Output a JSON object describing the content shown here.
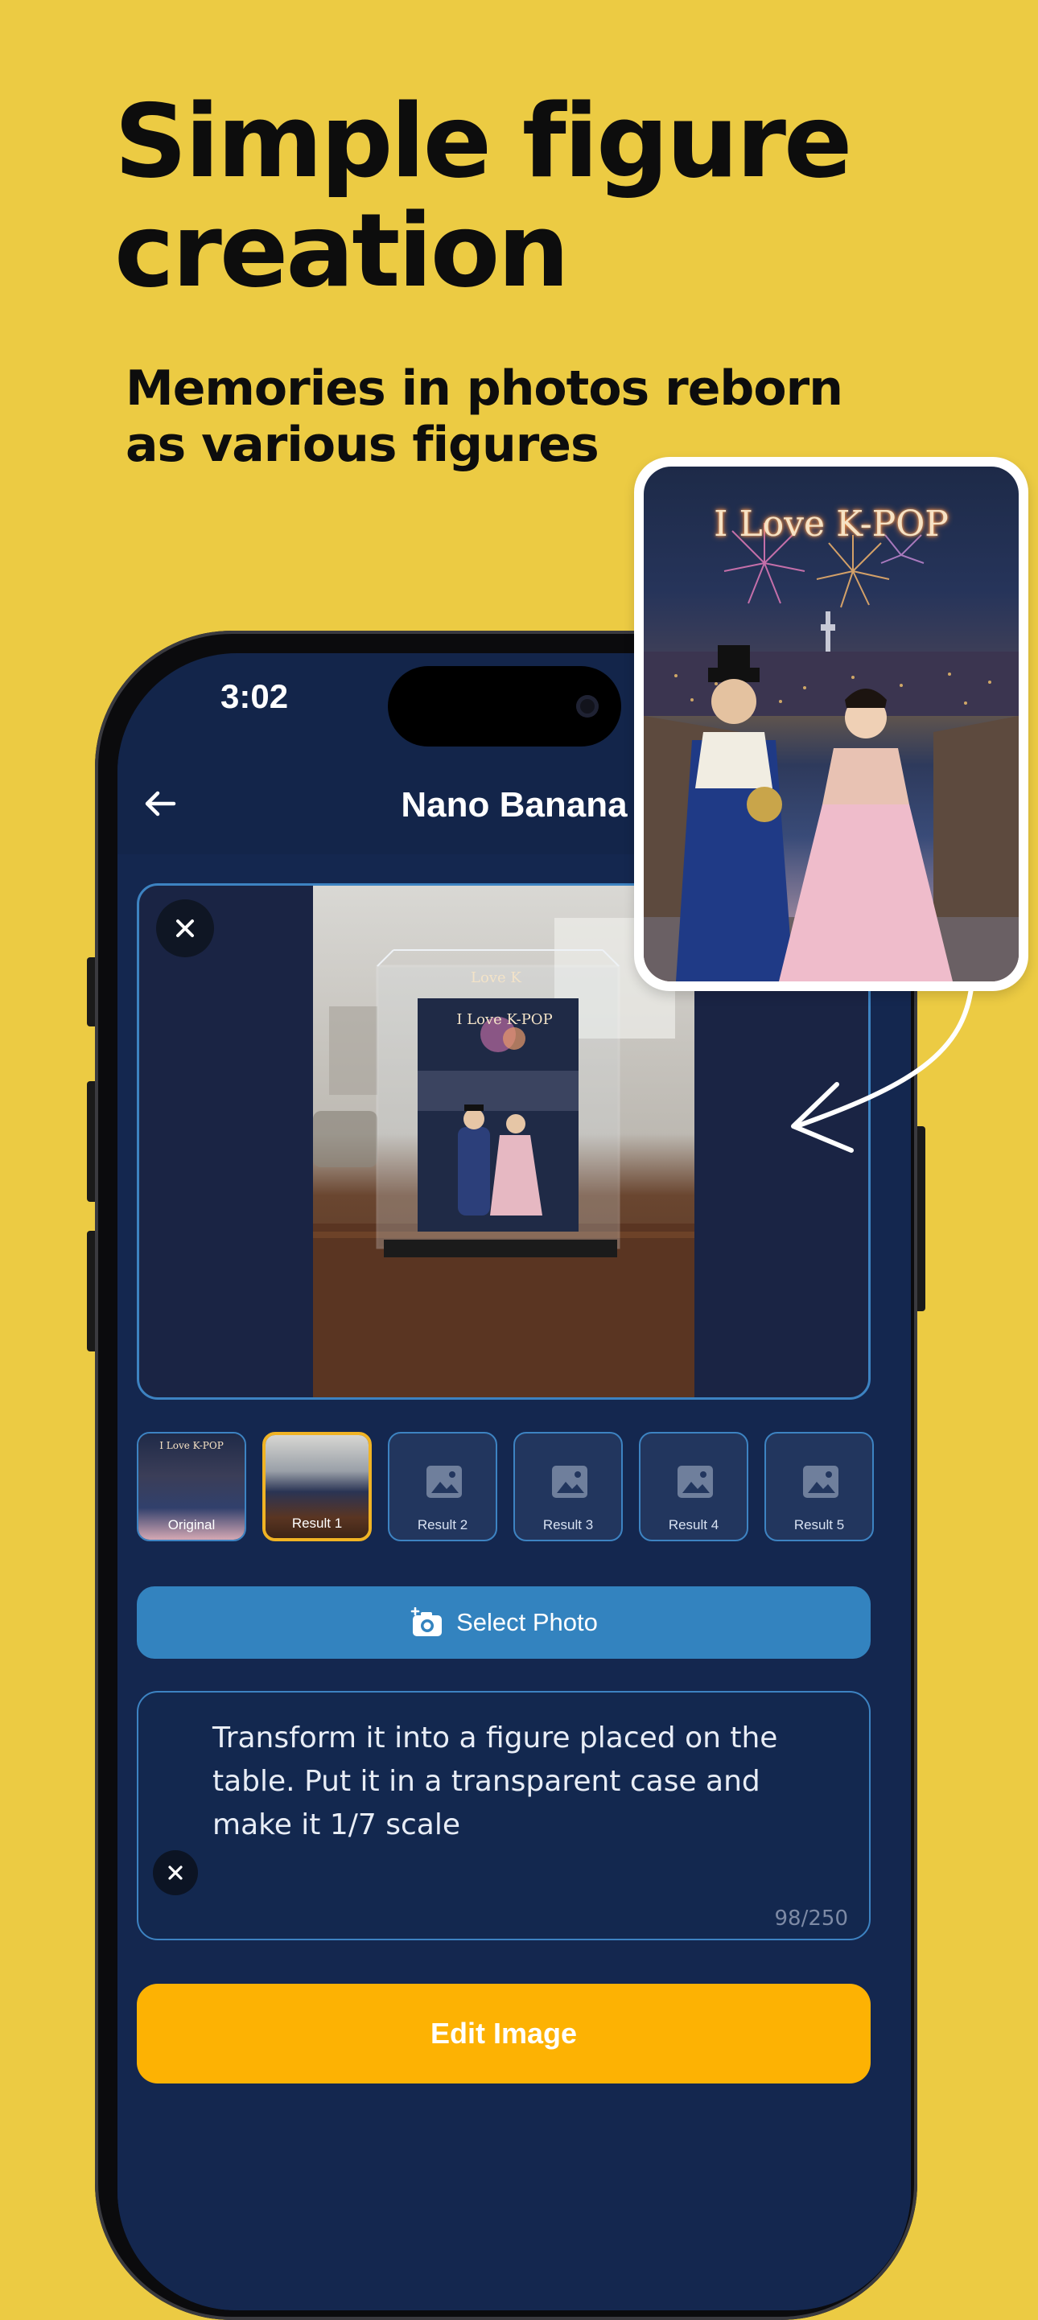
{
  "headline": "Simple figure creation",
  "subheadline": "Memories in photos reborn as various figures",
  "status_bar": {
    "time": "3:02"
  },
  "app_bar": {
    "title": "Nano Banana"
  },
  "preview": {
    "inner_caption_top": "Love K",
    "inner_caption": "I Love K-POP"
  },
  "popout": {
    "caption": "I Love K-POP"
  },
  "thumbnails": [
    {
      "label": "Original",
      "caption": "I Love K-POP",
      "state": "filled"
    },
    {
      "label": "Result 1",
      "state": "selected"
    },
    {
      "label": "Result 2",
      "state": "empty"
    },
    {
      "label": "Result 3",
      "state": "empty"
    },
    {
      "label": "Result 4",
      "state": "empty"
    },
    {
      "label": "Result 5",
      "state": "empty"
    }
  ],
  "select_photo": {
    "label": "Select Photo",
    "icon": "camera-plus-icon"
  },
  "prompt": {
    "text": "Transform it into a figure placed on the table. Put it in a transparent case and make it 1/7 scale",
    "counter": "98/250"
  },
  "edit_button": {
    "label": "Edit Image"
  },
  "colors": {
    "page_bg": "#ECCB43",
    "screen_bg": "#13254a",
    "accent_blue": "#3383bf",
    "accent_yellow": "#FDB203",
    "selected_border": "#f0b324"
  }
}
